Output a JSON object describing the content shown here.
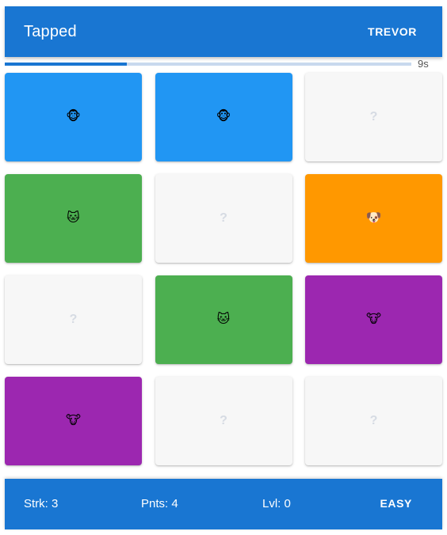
{
  "appbar": {
    "title": "Tapped",
    "user_label": "TREVOR"
  },
  "timer": {
    "remaining_label": "9s",
    "remaining_fraction": 0.3
  },
  "colors": {
    "primary": "#1976d2",
    "monkey": "#2196f3",
    "cat": "#4caf50",
    "dog": "#ff9800",
    "cow": "#9c27b0",
    "hidden": "#f7f7f7"
  },
  "cards": [
    {
      "state": "revealed",
      "glyph": "🐵",
      "icon": "monkey-face-icon",
      "color": "#2196f3"
    },
    {
      "state": "revealed",
      "glyph": "🐵",
      "icon": "monkey-face-icon",
      "color": "#2196f3"
    },
    {
      "state": "hidden",
      "glyph": "?",
      "icon": "question-mark-icon",
      "color": "#f7f7f7"
    },
    {
      "state": "revealed",
      "glyph": "🐱",
      "icon": "cat-face-icon",
      "color": "#4caf50"
    },
    {
      "state": "hidden",
      "glyph": "?",
      "icon": "question-mark-icon",
      "color": "#f7f7f7"
    },
    {
      "state": "revealed",
      "glyph": "🐶",
      "icon": "dog-face-icon",
      "color": "#ff9800"
    },
    {
      "state": "hidden",
      "glyph": "?",
      "icon": "question-mark-icon",
      "color": "#f7f7f7"
    },
    {
      "state": "revealed",
      "glyph": "🐱",
      "icon": "cat-face-icon",
      "color": "#4caf50"
    },
    {
      "state": "revealed",
      "glyph": "🐮",
      "icon": "cow-face-icon",
      "color": "#9c27b0"
    },
    {
      "state": "revealed",
      "glyph": "🐮",
      "icon": "cow-face-icon",
      "color": "#9c27b0"
    },
    {
      "state": "hidden",
      "glyph": "?",
      "icon": "question-mark-icon",
      "color": "#f7f7f7"
    },
    {
      "state": "hidden",
      "glyph": "?",
      "icon": "question-mark-icon",
      "color": "#f7f7f7"
    }
  ],
  "footer": {
    "streak": "Strk: 3",
    "points": "Pnts: 4",
    "level": "Lvl: 0",
    "difficulty": "EASY"
  }
}
